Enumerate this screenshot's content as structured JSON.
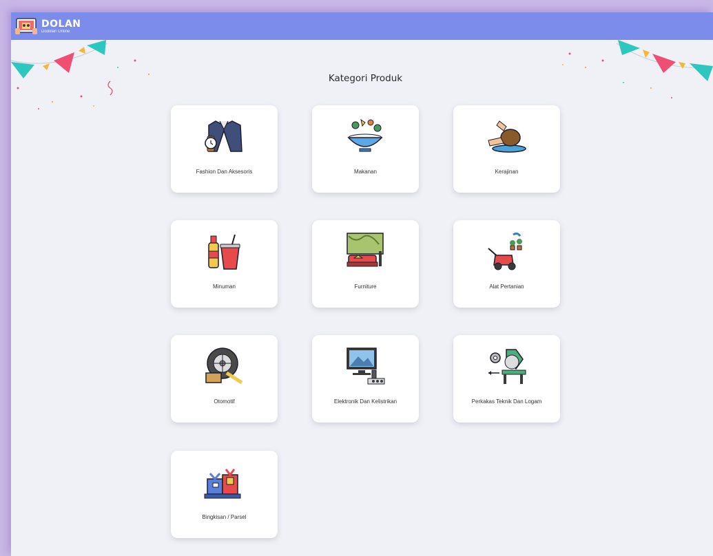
{
  "app": {
    "name": "DOLAN",
    "subtitle": "Dodolan Online"
  },
  "page": {
    "title": "Kategori Produk"
  },
  "categories": [
    {
      "label": "Fashion Dan Aksesoris",
      "icon": "jacket-watch-icon"
    },
    {
      "label": "Makanan",
      "icon": "salad-bowl-icon"
    },
    {
      "label": "Kerajinan",
      "icon": "pottery-icon"
    },
    {
      "label": "Minuman",
      "icon": "drinks-icon"
    },
    {
      "label": "Furniture",
      "icon": "sofa-icon"
    },
    {
      "label": "Alat Pertanian",
      "icon": "lawn-mower-icon"
    },
    {
      "label": "Otomotif",
      "icon": "tire-icon"
    },
    {
      "label": "Elektronik Dan Kelistrikan",
      "icon": "computer-icon"
    },
    {
      "label": "Perkakas Teknik Dan Logam",
      "icon": "saw-icon"
    },
    {
      "label": "Bingkisan / Parsel",
      "icon": "gift-parcel-icon"
    }
  ],
  "colors": {
    "topbar": "#7b8ceb",
    "background": "#f0f1f6",
    "card": "#ffffff"
  }
}
